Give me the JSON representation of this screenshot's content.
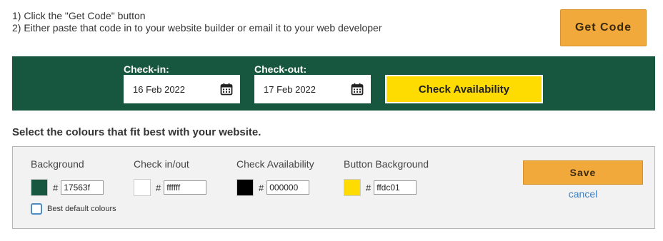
{
  "instructions": {
    "line1": "1) Click the \"Get Code\" button",
    "line2": "2) Either paste that code in to your website builder or email it to your web developer"
  },
  "get_code_label": "Get Code",
  "widget": {
    "background": "#17563f",
    "checkin_label": "Check-in:",
    "checkin_value": "16 Feb 2022",
    "checkout_label": "Check-out:",
    "checkout_value": "17 Feb 2022",
    "calendar_icon": "calendar-icon",
    "button_label": "Check Availability",
    "button_color": "#ffdc01"
  },
  "section_title": "Select the colours that fit best with your website.",
  "colours": [
    {
      "label": "Background",
      "hex": "17563f",
      "swatch": "#17563f"
    },
    {
      "label": "Check in/out",
      "hex": "ffffff",
      "swatch": "#ffffff"
    },
    {
      "label": "Check Availability",
      "hex": "000000",
      "swatch": "#000000"
    },
    {
      "label": "Button Background",
      "hex": "ffdc01",
      "swatch": "#ffdc01"
    }
  ],
  "best_default_label": "Best default colours",
  "best_default_checked": false,
  "save_label": "Save",
  "cancel_label": "cancel"
}
